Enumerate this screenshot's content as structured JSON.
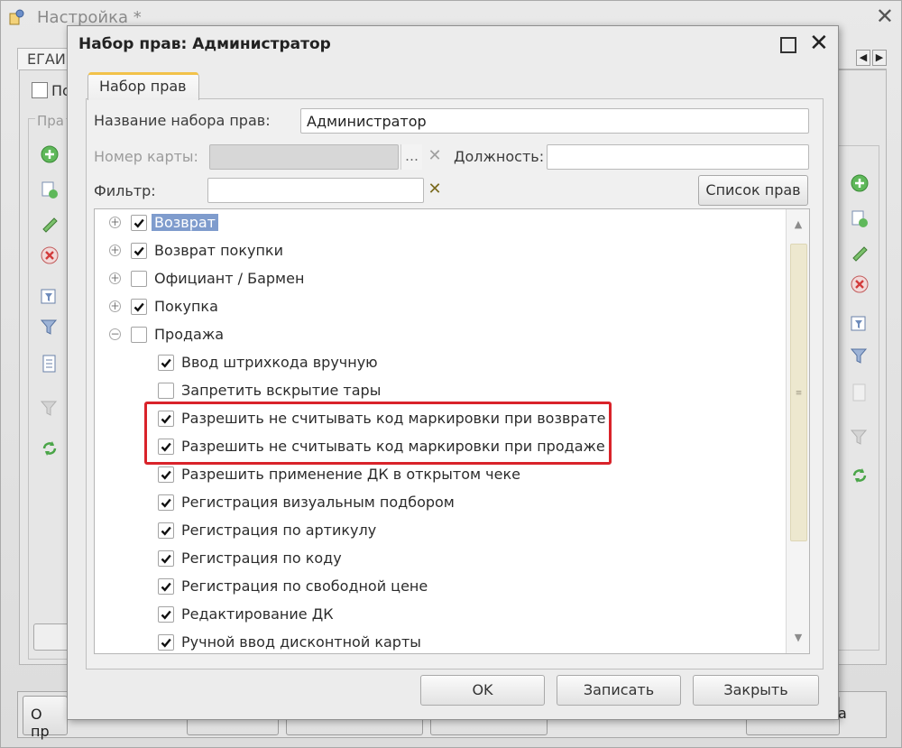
{
  "bg": {
    "title": "Настройка *",
    "tab": "ЕГАИ",
    "checkbox_label": "По",
    "group_label": "Пра",
    "bottom_buttons": [
      "О пр",
      "",
      "",
      "",
      "",
      "а"
    ]
  },
  "dialog": {
    "title": "Набор прав: Администратор",
    "tab": "Набор прав",
    "name_label": "Название набора прав:",
    "name_value": "Администратор",
    "card_label": "Номер карты:",
    "card_value": "",
    "position_label": "Должность:",
    "position_value": "",
    "filter_label": "Фильтр:",
    "filter_value": "",
    "rights_list_button": "Список прав",
    "ok_button": "OK",
    "save_button": "Записать",
    "close_button": "Закрыть"
  },
  "tree": [
    {
      "label": "Возврат",
      "level": 0,
      "expander": "+",
      "checked": true,
      "selected": true
    },
    {
      "label": "Возврат покупки",
      "level": 0,
      "expander": "+",
      "checked": true,
      "selected": false
    },
    {
      "label": "Официант / Бармен",
      "level": 0,
      "expander": "+",
      "checked": false,
      "selected": false
    },
    {
      "label": "Покупка",
      "level": 0,
      "expander": "+",
      "checked": true,
      "selected": false
    },
    {
      "label": "Продажа",
      "level": 0,
      "expander": "−",
      "checked": false,
      "selected": false
    },
    {
      "label": "Ввод штрихкода вручную",
      "level": 1,
      "checked": true
    },
    {
      "label": "Запретить вскрытие тары",
      "level": 1,
      "checked": false
    },
    {
      "label": "Разрешить не считывать код маркировки при возврате",
      "level": 1,
      "checked": true
    },
    {
      "label": "Разрешить не считывать код маркировки при продаже",
      "level": 1,
      "checked": true
    },
    {
      "label": "Разрешить применение ДК в открытом чеке",
      "level": 1,
      "checked": true
    },
    {
      "label": "Регистрация визуальным подбором",
      "level": 1,
      "checked": true
    },
    {
      "label": "Регистрация по артикулу",
      "level": 1,
      "checked": true
    },
    {
      "label": "Регистрация по коду",
      "level": 1,
      "checked": true
    },
    {
      "label": "Регистрация по свободной цене",
      "level": 1,
      "checked": true
    },
    {
      "label": "Редактирование ДК",
      "level": 1,
      "checked": true
    },
    {
      "label": "Ручной ввод дисконтной карты",
      "level": 1,
      "checked": true
    }
  ],
  "colors": {
    "highlight": "#d9232a",
    "selection": "#7f9ccd",
    "clear_red": "#c0392b",
    "clear_dark": "#7a6a1e",
    "tab_accent": "#f2c24a"
  }
}
